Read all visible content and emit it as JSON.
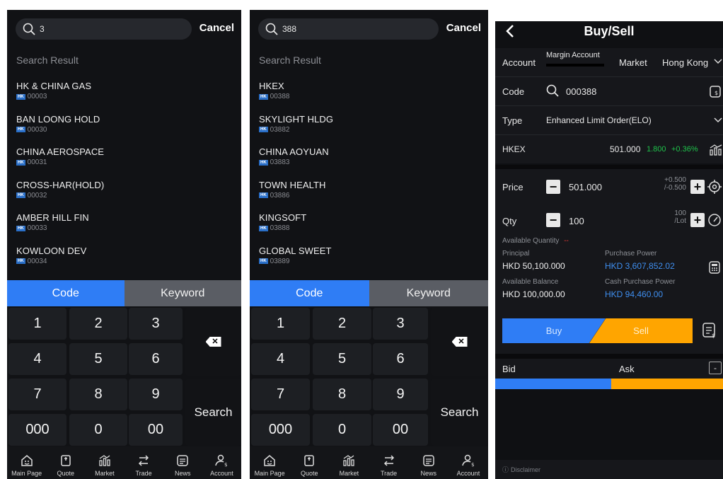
{
  "screen1": {
    "search_query": "3",
    "cancel_label": "Cancel",
    "section_label": "Search Result",
    "results": [
      {
        "name": "HK & CHINA GAS",
        "badge": "HK",
        "code": "00003"
      },
      {
        "name": "BAN LOONG HOLD",
        "badge": "HK",
        "code": "00030"
      },
      {
        "name": "CHINA AEROSPACE",
        "badge": "HK",
        "code": "00031"
      },
      {
        "name": "CROSS-HAR(HOLD)",
        "badge": "HK",
        "code": "00032"
      },
      {
        "name": "AMBER HILL FIN",
        "badge": "HK",
        "code": "00033"
      },
      {
        "name": "KOWLOON DEV",
        "badge": "HK",
        "code": "00034"
      }
    ],
    "tabs": {
      "code": "Code",
      "keyword": "Keyword"
    },
    "keys": [
      "1",
      "2",
      "3",
      "4",
      "5",
      "6",
      "7",
      "8",
      "9",
      "000",
      "0",
      "00"
    ],
    "search_key": "Search"
  },
  "screen2": {
    "search_query": "388",
    "cancel_label": "Cancel",
    "section_label": "Search Result",
    "results": [
      {
        "name": "HKEX",
        "badge": "HK",
        "code": "00388"
      },
      {
        "name": "SKYLIGHT HLDG",
        "badge": "HK",
        "code": "03882"
      },
      {
        "name": "CHINA AOYUAN",
        "badge": "HK",
        "code": "03883"
      },
      {
        "name": "TOWN HEALTH",
        "badge": "HK",
        "code": "03886"
      },
      {
        "name": "KINGSOFT",
        "badge": "HK",
        "code": "03888"
      },
      {
        "name": "GLOBAL SWEET",
        "badge": "HK",
        "code": "03889"
      }
    ],
    "tabs": {
      "code": "Code",
      "keyword": "Keyword"
    },
    "keys": [
      "1",
      "2",
      "3",
      "4",
      "5",
      "6",
      "7",
      "8",
      "9",
      "000",
      "0",
      "00"
    ],
    "search_key": "Search"
  },
  "nav": [
    {
      "label": "Main Page",
      "icon": "home-icon"
    },
    {
      "label": "Quote",
      "icon": "quote-icon"
    },
    {
      "label": "Market",
      "icon": "market-icon"
    },
    {
      "label": "Trade",
      "icon": "trade-icon"
    },
    {
      "label": "News",
      "icon": "news-icon"
    },
    {
      "label": "Account",
      "icon": "account-icon"
    }
  ],
  "trade": {
    "title": "Buy/Sell",
    "account_label": "Account",
    "account_value": "Margin Account",
    "market_label": "Market",
    "market_value": "Hong Kong",
    "code_label": "Code",
    "code_value": "000388",
    "type_label": "Type",
    "type_value": "Enhanced Limit Order(ELO)",
    "stock_name": "HKEX",
    "last_price": "501.000",
    "change": "1.800",
    "change_pct": "+0.36%",
    "price_label": "Price",
    "price_value": "501.000",
    "price_spread_up": "+0.500",
    "price_spread_down": "/-0.500",
    "qty_label": "Qty",
    "qty_value": "100",
    "lot_size": "100",
    "lot_unit": "/Lot",
    "available_qty_label": "Available Quantity",
    "available_qty_value": "--",
    "principal_label": "Principal",
    "principal_value": "HKD 50,100.000",
    "purchase_power_label": "Purchase Power",
    "purchase_power_value": "HKD 3,607,852.02",
    "available_balance_label": "Available Balance",
    "available_balance_value": "HKD 100,000.00",
    "cash_purchase_power_label": "Cash Purchase Power",
    "cash_purchase_power_value": "HKD 94,460.00",
    "buy_label": "Buy",
    "sell_label": "Sell",
    "bid_label": "Bid",
    "ask_label": "Ask",
    "collapse_symbol": "-",
    "bid_ratio": 0.51,
    "disclaimer": "Disclaimer",
    "colors": {
      "buy": "#2f7df5",
      "sell": "#ffa500",
      "up": "#1fc24b",
      "link": "#3f8ff0"
    }
  }
}
